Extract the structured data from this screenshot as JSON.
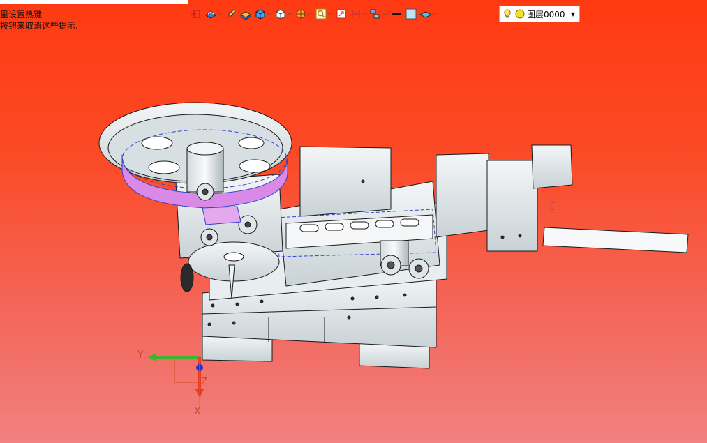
{
  "hints": {
    "line1": "里设置热键",
    "line2": "按钮来取消这些提示."
  },
  "toolbar": {
    "items": [
      {
        "name": "select-filter-icon",
        "dropdown": false
      },
      {
        "name": "snap-options-icon",
        "dropdown": true
      },
      {
        "name": "pencil-icon",
        "dropdown": false
      },
      {
        "name": "shaded-view-icon",
        "dropdown": false
      },
      {
        "name": "shaded-edges-icon",
        "dropdown": true
      },
      {
        "name": "view-cube-icon",
        "dropdown": true
      },
      {
        "name": "render-style-icon",
        "dropdown": true
      },
      {
        "name": "zoom-icon",
        "dropdown": true
      },
      {
        "name": "fit-view-icon",
        "dropdown": false
      },
      {
        "name": "section-view-icon",
        "dropdown": true
      },
      {
        "name": "assembly-icon",
        "dropdown": true
      },
      {
        "name": "line-color-icon",
        "dropdown": false
      },
      {
        "name": "fill-color-icon",
        "dropdown": false
      },
      {
        "name": "layer-plane-icon",
        "dropdown": true
      }
    ]
  },
  "layer": {
    "label": "图层0000"
  },
  "triad": {
    "x": "X",
    "y": "Y",
    "z": "Z"
  },
  "colors": {
    "bg_top": "#ff3a12",
    "bg_bottom": "#f08180",
    "part_face": "#e9eef0",
    "part_edge": "#1a1a1a",
    "highlight": "#d98ae6",
    "select_line": "#3344cc",
    "axis_x": "#e53b1f",
    "axis_y": "#3fb52e",
    "axis_z": "#2233cc"
  }
}
